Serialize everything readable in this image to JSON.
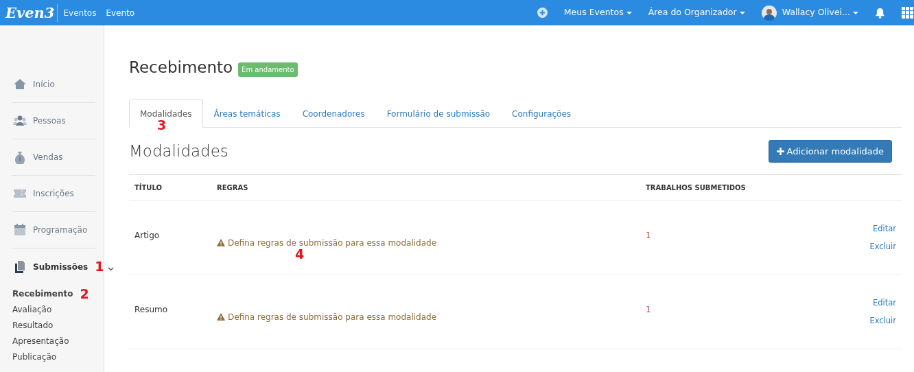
{
  "navbar": {
    "logo": "Even3",
    "breadcrumb": [
      {
        "label": "Eventos",
        "selected": false
      },
      {
        "label": "Evento",
        "selected": true
      }
    ],
    "menus": [
      {
        "label": "Meus Eventos"
      },
      {
        "label": "Área do Organizador"
      },
      {
        "label": "Wallacy Olivei...",
        "kind": "user"
      }
    ]
  },
  "sidebar": {
    "items": [
      {
        "label": "Início",
        "selected": false
      },
      {
        "label": "Pessoas",
        "selected": false
      },
      {
        "label": "Vendas",
        "selected": false
      },
      {
        "label": "Inscrições",
        "selected": false
      },
      {
        "label": "Programação",
        "selected": false
      },
      {
        "label": "Submissões",
        "selected": true,
        "expanded": true,
        "annotation": "1",
        "children": [
          {
            "label": "Recebimento",
            "selected": true,
            "annotation": "2"
          },
          {
            "label": "Avaliação",
            "selected": false
          },
          {
            "label": "Resultado",
            "selected": false
          },
          {
            "label": "Apresentação",
            "selected": false
          },
          {
            "label": "Publicação",
            "selected": false
          }
        ]
      }
    ]
  },
  "page": {
    "title": "Recebimento",
    "status_badge": "Em andamento"
  },
  "tabs": [
    {
      "label": "Modalidades",
      "selected": true,
      "annotation": "3"
    },
    {
      "label": "Áreas temáticas",
      "selected": false
    },
    {
      "label": "Coordenadores",
      "selected": false
    },
    {
      "label": "Formulário de submissão",
      "selected": false
    },
    {
      "label": "Configurações",
      "selected": false
    }
  ],
  "section": {
    "title": "Modalidades",
    "add_button": "Adicionar modalidade"
  },
  "table": {
    "columns": [
      "TÍTULO",
      "REGRAS",
      "TRABALHOS SUBMETIDOS"
    ],
    "rows": [
      {
        "title": "Artigo",
        "rules": "Defina regras de submissão para essa modalidade",
        "rules_annotation": "4",
        "submitted": "1",
        "actions": [
          "Editar",
          "Excluir"
        ]
      },
      {
        "title": "Resumo",
        "rules": "Defina regras de submissão para essa modalidade",
        "submitted": "1",
        "actions": [
          "Editar",
          "Excluir"
        ]
      }
    ]
  }
}
